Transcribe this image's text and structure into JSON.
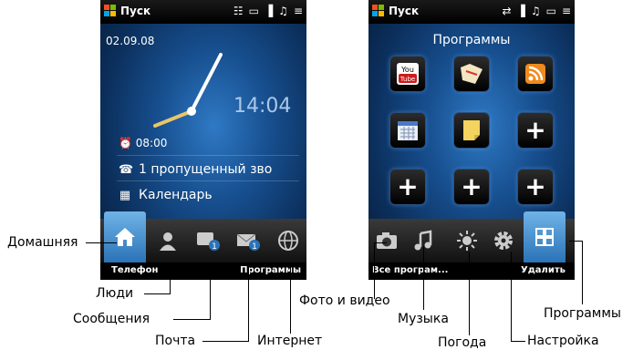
{
  "left_screen": {
    "status": {
      "start_label": "Пуск"
    },
    "date": "02.09.08",
    "time": "14:04",
    "alarm": "08:00",
    "missed_call": "1 пропущенный зво",
    "calendar": "Календарь",
    "softkeys": {
      "left": "Телефон",
      "right": "Программы"
    },
    "tabs": [
      {
        "icon": "home-icon"
      },
      {
        "icon": "people-icon"
      },
      {
        "icon": "messages-icon",
        "badge": "1"
      },
      {
        "icon": "mail-icon",
        "badge": "1"
      },
      {
        "icon": "internet-icon"
      }
    ]
  },
  "right_screen": {
    "status": {
      "start_label": "Пуск"
    },
    "title": "Программы",
    "softkeys": {
      "left": "Все програм...",
      "right": "Удалить"
    },
    "apps": [
      {
        "icon": "youtube-icon",
        "label": "You Tube"
      },
      {
        "icon": "map-icon"
      },
      {
        "icon": "rss-icon"
      },
      {
        "icon": "calendar-app-icon"
      },
      {
        "icon": "notes-icon"
      },
      {
        "icon": "add-icon",
        "label": "+"
      },
      {
        "icon": "add-icon",
        "label": "+"
      },
      {
        "icon": "add-icon",
        "label": "+"
      },
      {
        "icon": "add-icon",
        "label": "+"
      }
    ],
    "tabs": [
      {
        "icon": "camera-icon"
      },
      {
        "icon": "music-icon"
      },
      {
        "icon": "weather-icon"
      },
      {
        "icon": "settings-icon"
      },
      {
        "icon": "programs-grid-icon"
      }
    ]
  },
  "callouts": {
    "home": "Домашняя",
    "people": "Люди",
    "messages": "Сообщения",
    "mail": "Почта",
    "internet": "Интернет",
    "photo": "Фото и видео",
    "music": "Музыка",
    "weather": "Погода",
    "settings": "Настройка",
    "programs": "Программы"
  }
}
